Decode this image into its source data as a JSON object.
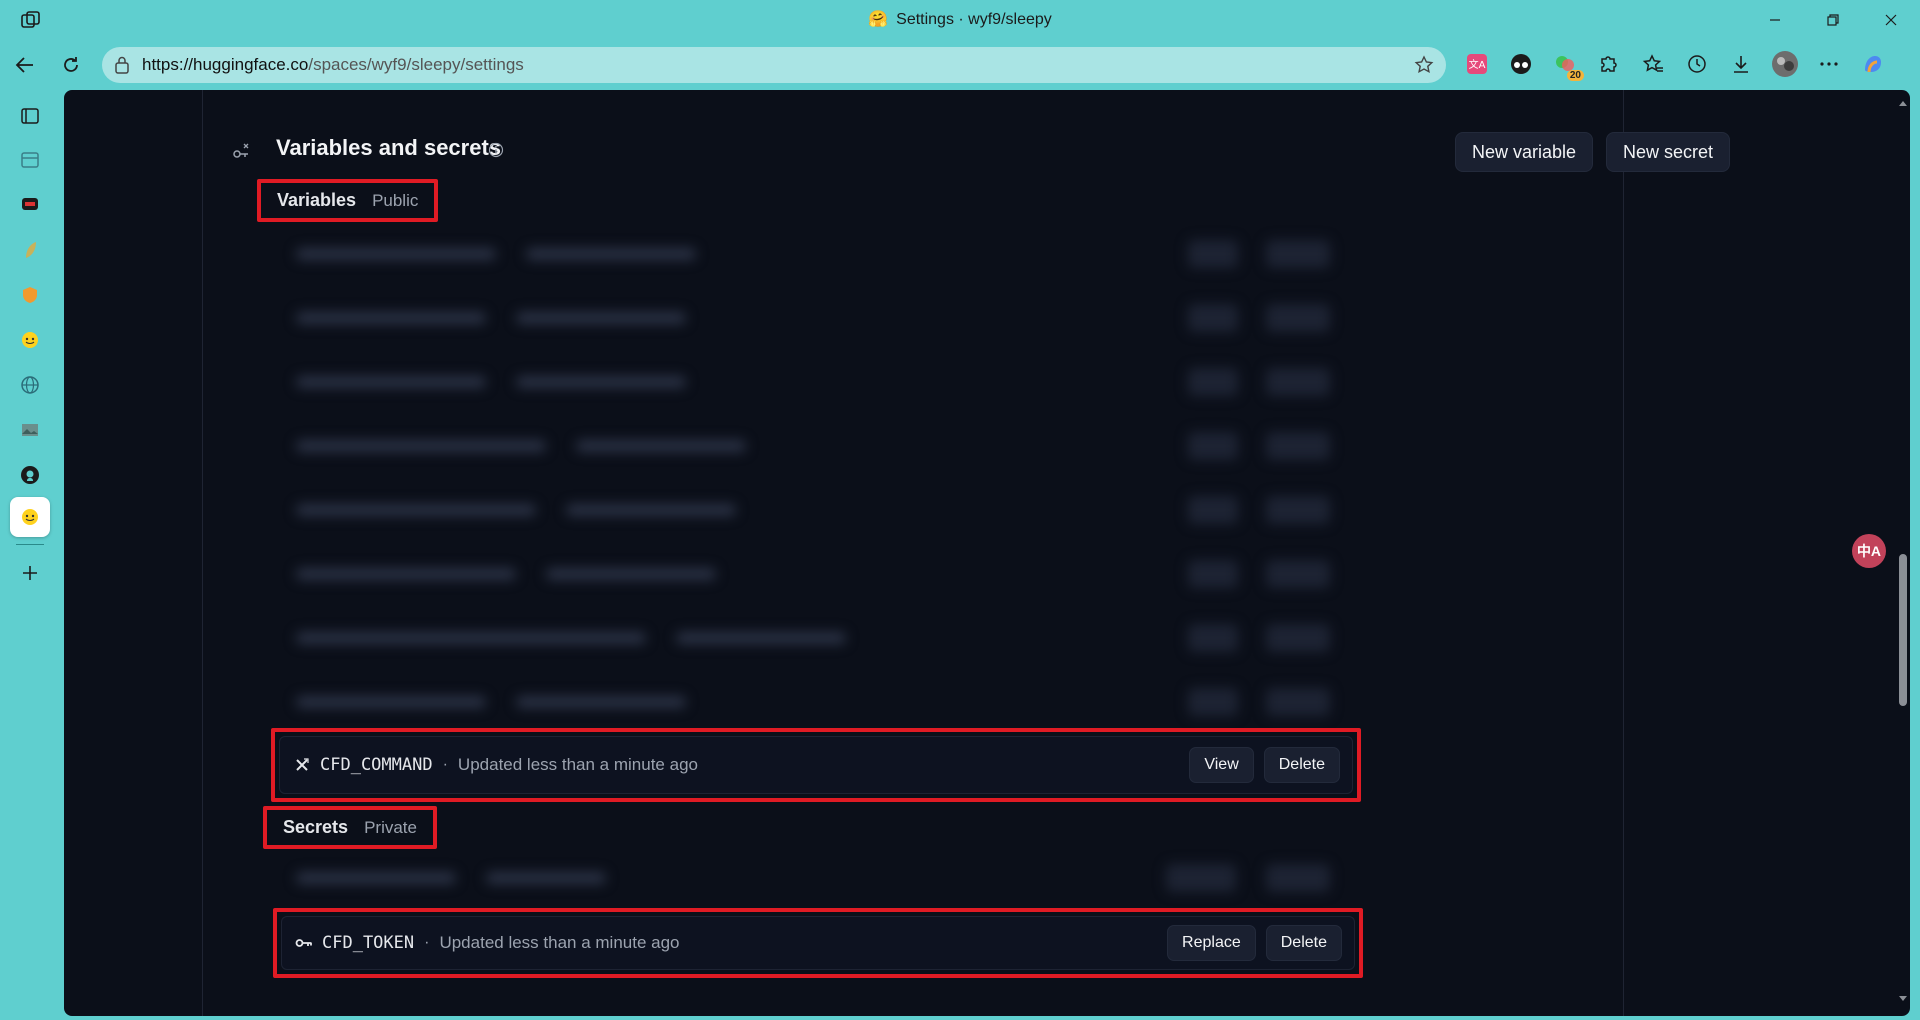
{
  "window": {
    "title": "Settings · wyf9/sleepy",
    "title_emoji": "🤗"
  },
  "address_bar": {
    "url_host": "https://huggingface.co",
    "url_path": "/spaces/wyf9/sleepy/settings"
  },
  "extensions": {
    "badge_count": "20"
  },
  "section": {
    "title": "Variables and secrets",
    "new_variable_label": "New variable",
    "new_secret_label": "New secret"
  },
  "variables": {
    "heading": "Variables",
    "subheading": "Public",
    "highlighted": {
      "name": "CFD_COMMAND",
      "separator": "·",
      "updated": "Updated less than a minute ago",
      "view_label": "View",
      "delete_label": "Delete"
    }
  },
  "secrets": {
    "heading": "Secrets",
    "subheading": "Private",
    "highlighted": {
      "name": "CFD_TOKEN",
      "separator": "·",
      "updated": "Updated less than a minute ago",
      "replace_label": "Replace",
      "delete_label": "Delete"
    }
  },
  "floating_translate_label": "中A",
  "colors": {
    "page_bg": "#0b0f19",
    "highlight_border": "#e01b24",
    "browser_chrome": "#5fcfcf"
  }
}
